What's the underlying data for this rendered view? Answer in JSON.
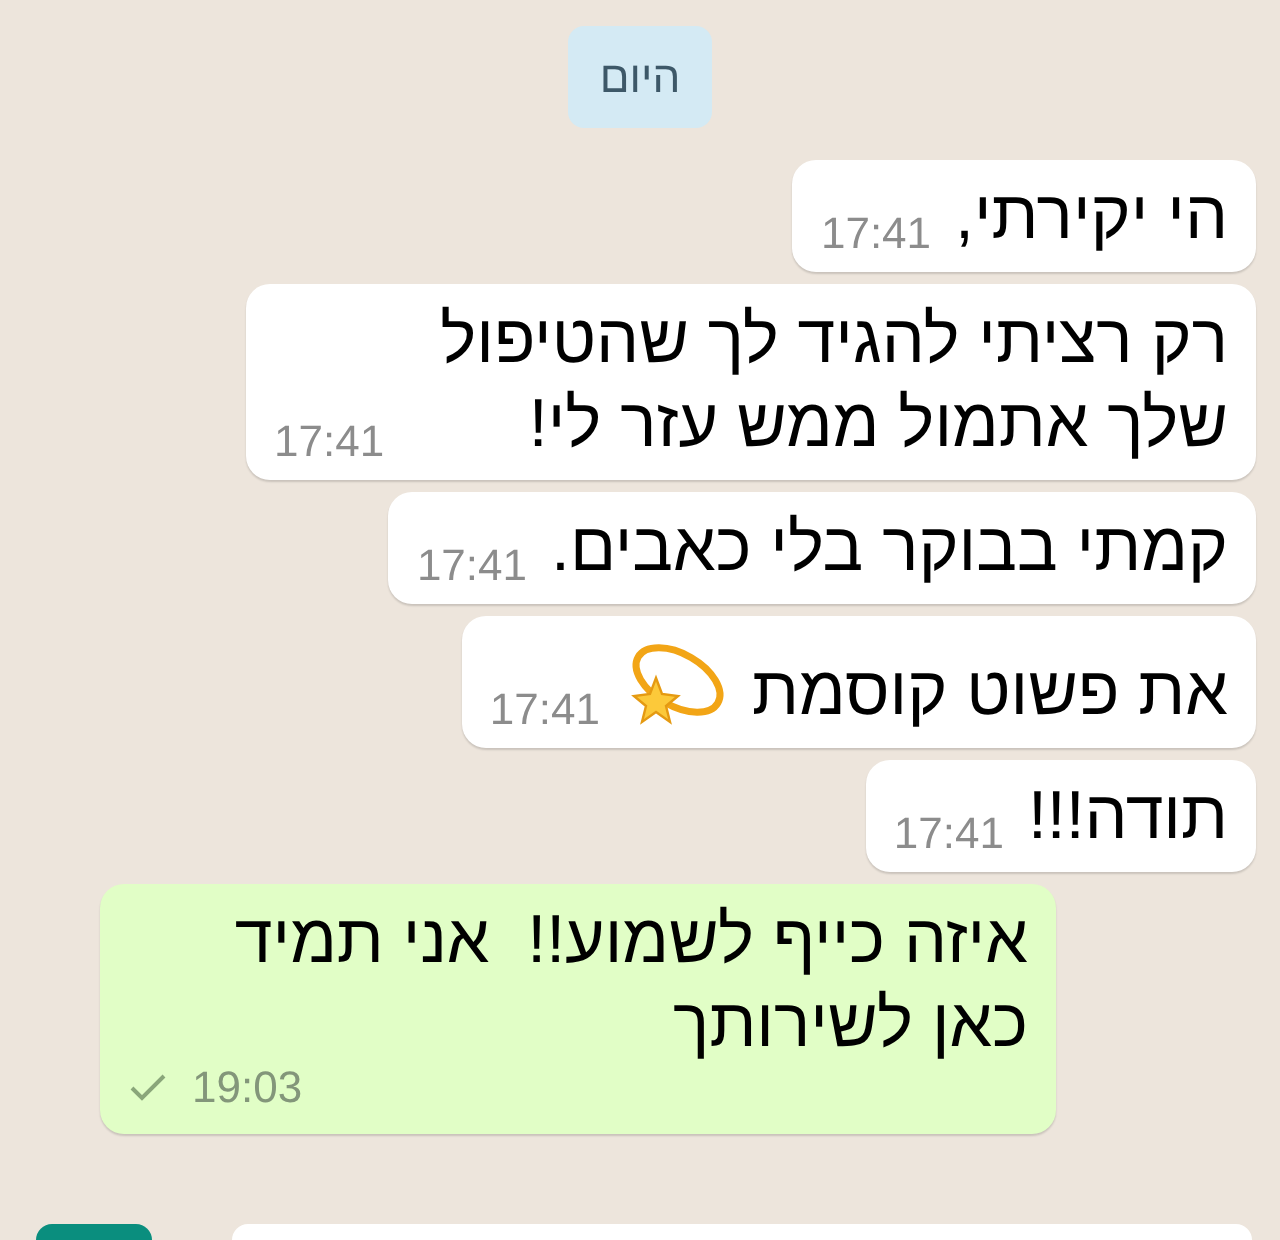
{
  "date_chip": "היום",
  "messages": [
    {
      "kind": "received",
      "text": "הי יקירתי,",
      "time": "17:41"
    },
    {
      "kind": "received",
      "text": "רק רציתי להגיד לך שהטיפול שלך אתמול ממש עזר לי!",
      "time": "17:41"
    },
    {
      "kind": "received",
      "text": "קמתי בבוקר בלי כאבים.",
      "time": "17:41"
    },
    {
      "kind": "received",
      "text": "את פשוט קוסמת",
      "time": "17:41",
      "emoji": true
    },
    {
      "kind": "received",
      "text": "תודה!!!",
      "time": "17:41"
    },
    {
      "kind": "sent",
      "text": "איזה כייף לשמוע!!  אני תמיד כאן לשירותך",
      "time": "19:03",
      "read": false
    }
  ]
}
